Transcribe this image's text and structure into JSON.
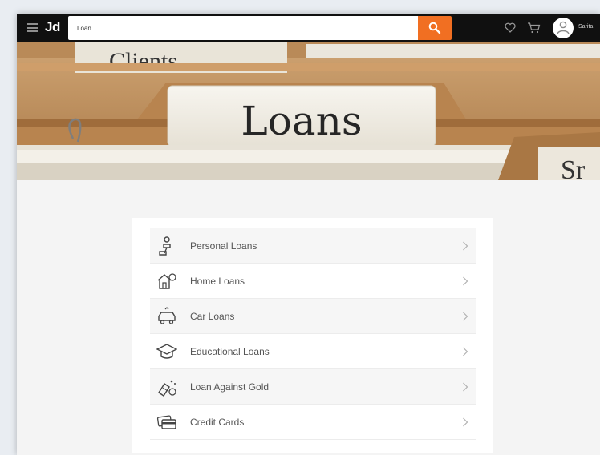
{
  "header": {
    "logo": "Jd",
    "search": {
      "value": "Loan"
    },
    "user": {
      "name": "Sarita"
    }
  },
  "banner": {
    "tab_main": "Loans",
    "tab_back": "Clients",
    "tab_side": "Sr"
  },
  "loans": {
    "items": [
      {
        "label": "Personal Loans",
        "icon": "person-money-icon"
      },
      {
        "label": "Home Loans",
        "icon": "home-money-icon"
      },
      {
        "label": "Car Loans",
        "icon": "car-icon"
      },
      {
        "label": "Educational Loans",
        "icon": "graduation-cap-icon"
      },
      {
        "label": "Loan Against Gold",
        "icon": "gold-coins-icon"
      },
      {
        "label": "Credit Cards",
        "icon": "credit-card-icon"
      }
    ]
  },
  "colors": {
    "topbar": "#101010",
    "search_button": "#f16f22",
    "folder": "#b8844f",
    "tab_paper": "#f2efe6"
  }
}
